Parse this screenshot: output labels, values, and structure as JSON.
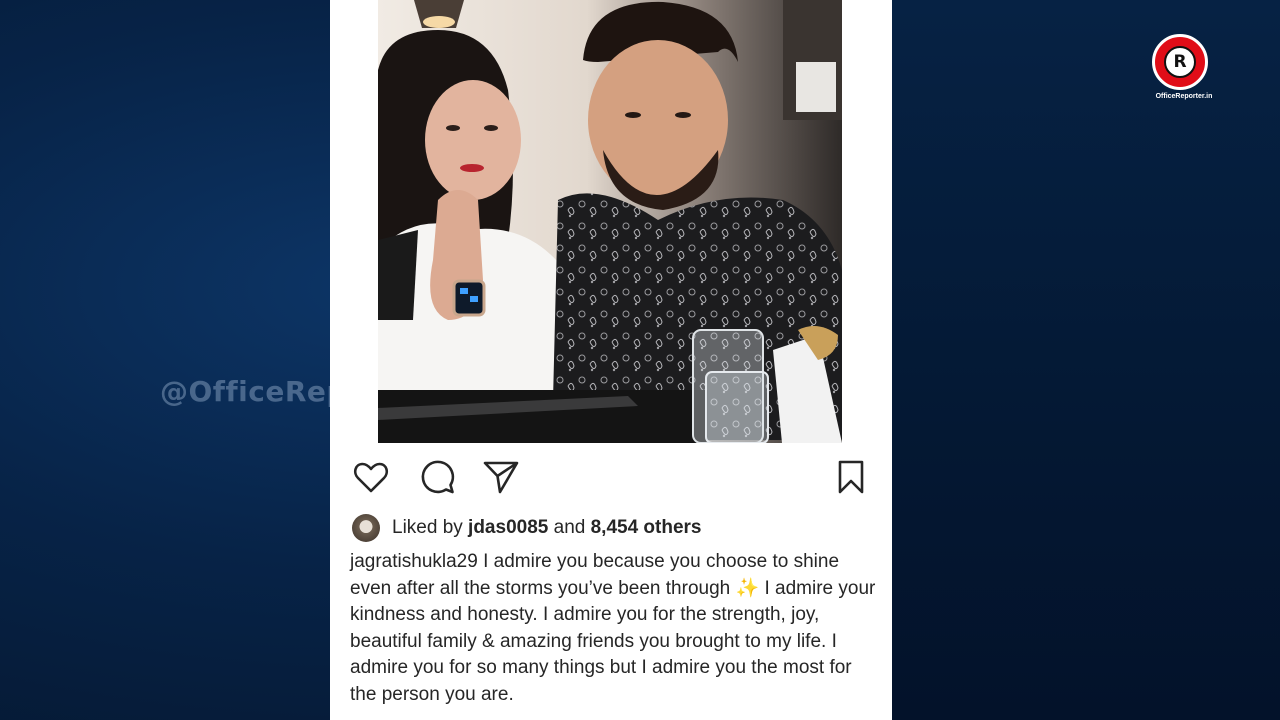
{
  "watermark": "@OfficeReporter",
  "logo": {
    "letter": "R",
    "text": "OfficeReporter.in",
    "ring_color": "#e00d18"
  },
  "post": {
    "actions": {
      "like_icon": "heart-outline-icon",
      "comment_icon": "speech-bubble-icon",
      "share_icon": "paper-plane-icon",
      "save_icon": "bookmark-outline-icon"
    },
    "likes": {
      "prefix": "Liked by ",
      "user": "jdas0085",
      "middle": " and ",
      "count_text": "8,454 others"
    },
    "caption": {
      "username": "jagratishukla29",
      "text_before_emoji": " I admire you because you choose to shine even after all the storms you’ve been through ",
      "emoji": "✨",
      "text_after_emoji": " I admire your kindness and honesty. I admire you for the strength, joy, beautiful family & amazing friends you brought to my life. I admire you for so many things but I admire you the most for the person you are."
    }
  }
}
